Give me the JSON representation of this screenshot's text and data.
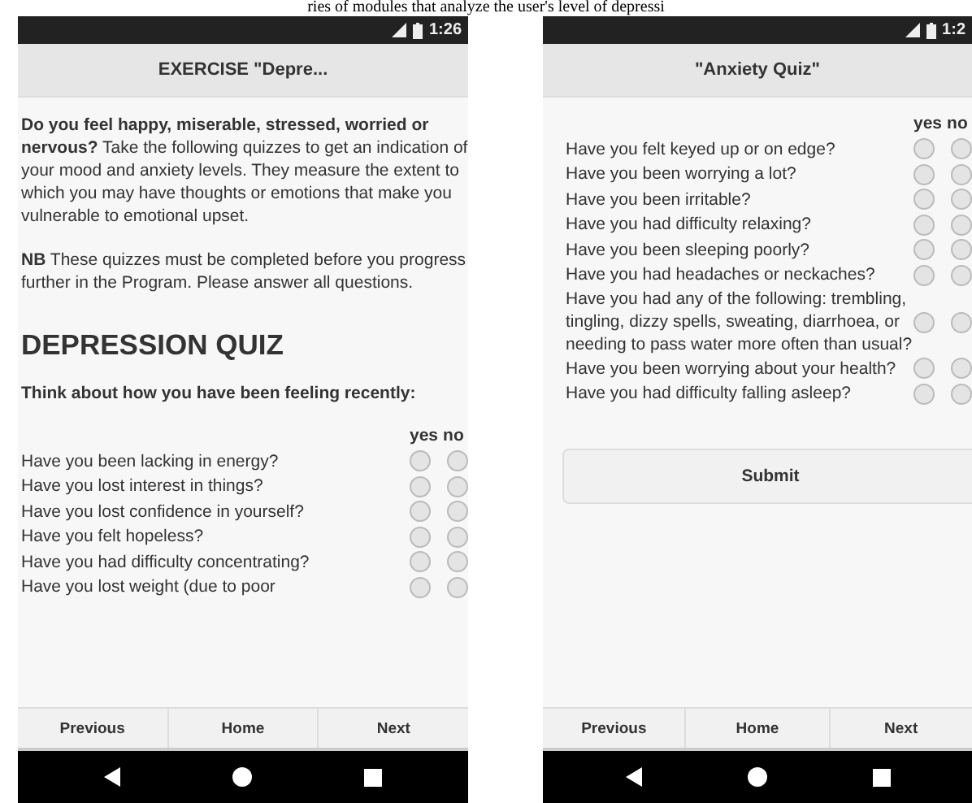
{
  "caption": "ries of modules that analyze the user's level of depressi",
  "phones": [
    {
      "status_time": "1:26",
      "title": "EXERCISE \"Depre...",
      "blocks": [
        {
          "kind": "paragraph",
          "text": "**Do you feel happy, miserable, stressed, worried or nervous?** Take the following quizzes to get an indication of your mood and anxiety levels. They measure the extent to which you may have thoughts or emotions that make you vulnerable to emotional upset."
        },
        {
          "kind": "paragraph",
          "text": "**NB** These quizzes must be completed before you progress further in the Program. Please answer all questions."
        },
        {
          "kind": "heading",
          "text": "DEPRESSION QUIZ"
        },
        {
          "kind": "subheading",
          "text": "Think about how you have been feeling recently:"
        },
        {
          "kind": "quiz",
          "yes_label": "yes",
          "no_label": "no",
          "questions": [
            {
              "text": "Have you been lacking in energy?",
              "yes": false,
              "no": false
            },
            {
              "text": "Have you lost interest in things?",
              "yes": false,
              "no": false
            },
            {
              "text": "Have you lost confidence in yourself?",
              "yes": false,
              "no": false
            },
            {
              "text": "Have you felt hopeless?",
              "yes": false,
              "no": false
            },
            {
              "text": "Have you had difficulty concentrating?",
              "yes": false,
              "no": false
            },
            {
              "text": "Have you lost weight (due to poor",
              "yes": false,
              "no": false
            }
          ]
        }
      ],
      "footer": [
        "Previous",
        "Home",
        "Next"
      ]
    },
    {
      "status_time": "1:2",
      "title": "\"Anxiety Quiz\"",
      "blocks": [
        {
          "kind": "quiz",
          "yes_label": "yes",
          "no_label": "no",
          "questions": [
            {
              "text": "Have you felt keyed up or on edge?",
              "yes": false,
              "no": false
            },
            {
              "text": "Have you been worrying a lot?",
              "yes": false,
              "no": false
            },
            {
              "text": "Have you been irritable?",
              "yes": false,
              "no": false
            },
            {
              "text": "Have you had difficulty relaxing?",
              "yes": false,
              "no": false
            },
            {
              "text": "Have you been sleeping poorly?",
              "yes": false,
              "no": false
            },
            {
              "text": "Have you had headaches or neckaches?",
              "yes": false,
              "no": false
            },
            {
              "text": "Have you had any of the following: trembling, tingling, dizzy spells, sweating, diarrhoea, or needing to pass water more often than usual?",
              "yes": false,
              "no": false
            },
            {
              "text": "Have you been worrying about your health?",
              "yes": false,
              "no": false
            },
            {
              "text": "Have you had difficulty falling asleep?",
              "yes": false,
              "no": false
            }
          ]
        },
        {
          "kind": "button",
          "text": "Submit"
        }
      ],
      "footer": [
        "Previous",
        "Home",
        "Next"
      ]
    }
  ]
}
